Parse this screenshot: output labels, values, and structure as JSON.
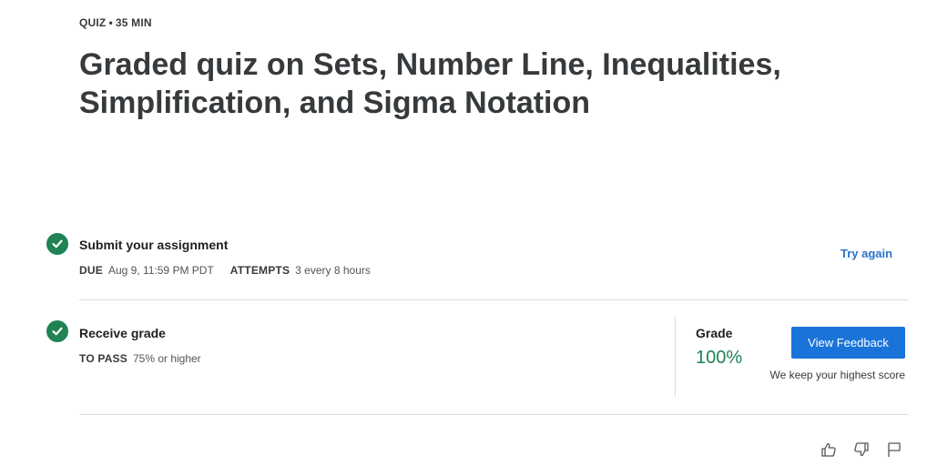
{
  "header": {
    "type_label": "QUIZ",
    "separator": "•",
    "duration": "35 MIN",
    "title": "Graded quiz on Sets, Number Line, Inequalities, Simplification, and Sigma Notation"
  },
  "submit_step": {
    "title": "Submit your assignment",
    "due_label": "DUE",
    "due_value": "Aug 9, 11:59 PM PDT",
    "attempts_label": "ATTEMPTS",
    "attempts_value": "3 every 8 hours",
    "action_label": "Try again"
  },
  "grade_step": {
    "title": "Receive grade",
    "to_pass_label": "TO PASS",
    "to_pass_value": "75% or higher",
    "grade_label": "Grade",
    "grade_value": "100%",
    "feedback_button": "View Feedback",
    "note": "We keep your highest score"
  },
  "footer": {
    "icons": [
      "thumbs-up-icon",
      "thumbs-down-icon",
      "flag-icon"
    ]
  },
  "colors": {
    "success": "#1f8354",
    "primary": "#1a73d9",
    "link": "#2a73cc"
  }
}
